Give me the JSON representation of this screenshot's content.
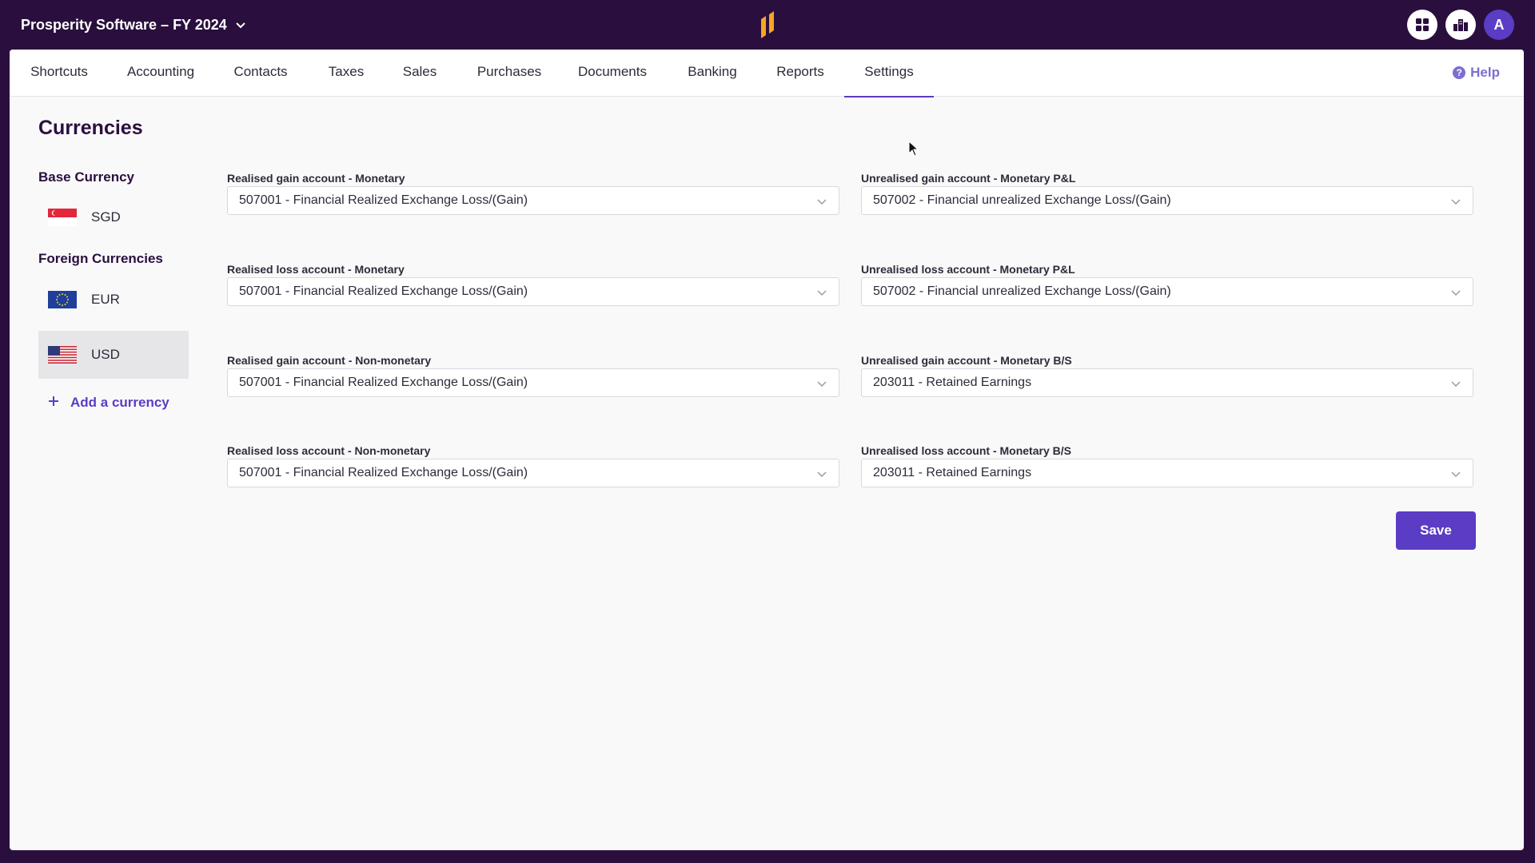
{
  "topbar": {
    "org_name": "Prosperity Software – FY 2024",
    "avatar_initial": "A",
    "icons": [
      "apps-grid-icon",
      "building-icon"
    ]
  },
  "nav": {
    "tabs": [
      "Shortcuts",
      "Accounting",
      "Contacts",
      "Taxes",
      "Sales",
      "Purchases",
      "Documents",
      "Banking",
      "Reports",
      "Settings"
    ],
    "active_tab": "Settings",
    "help_label": "Help"
  },
  "page": {
    "title": "Currencies"
  },
  "sidebar": {
    "base_heading": "Base Currency",
    "base_currency": "SGD",
    "foreign_heading": "Foreign Currencies",
    "foreign_currencies": [
      "EUR",
      "USD"
    ],
    "selected": "USD",
    "add_label": "Add a currency"
  },
  "fields": {
    "realised_gain_monetary": {
      "label": "Realised gain account - Monetary",
      "value": "507001 - Financial Realized Exchange Loss/(Gain)"
    },
    "unrealised_gain_monetary_pl": {
      "label": "Unrealised gain account - Monetary P&L",
      "value": "507002 - Financial unrealized Exchange Loss/(Gain)"
    },
    "realised_loss_monetary": {
      "label": "Realised loss account - Monetary",
      "value": "507001 - Financial Realized Exchange Loss/(Gain)"
    },
    "unrealised_loss_monetary_pl": {
      "label": "Unrealised loss account - Monetary P&L",
      "value": "507002 - Financial unrealized Exchange Loss/(Gain)"
    },
    "realised_gain_nonmonetary": {
      "label": "Realised gain account - Non-monetary",
      "value": "507001 - Financial Realized Exchange Loss/(Gain)"
    },
    "unrealised_gain_monetary_bs": {
      "label": "Unrealised gain account - Monetary B/S",
      "value": "203011 - Retained Earnings"
    },
    "realised_loss_nonmonetary": {
      "label": "Realised loss account - Non-monetary",
      "value": "507001 - Financial Realized Exchange Loss/(Gain)"
    },
    "unrealised_loss_monetary_bs": {
      "label": "Unrealised loss account - Monetary B/S",
      "value": "203011 - Retained Earnings"
    }
  },
  "actions": {
    "save_label": "Save"
  },
  "colors": {
    "header_bg": "#2a0f3e",
    "accent": "#5b3cc4",
    "logo": "#f5a623"
  }
}
